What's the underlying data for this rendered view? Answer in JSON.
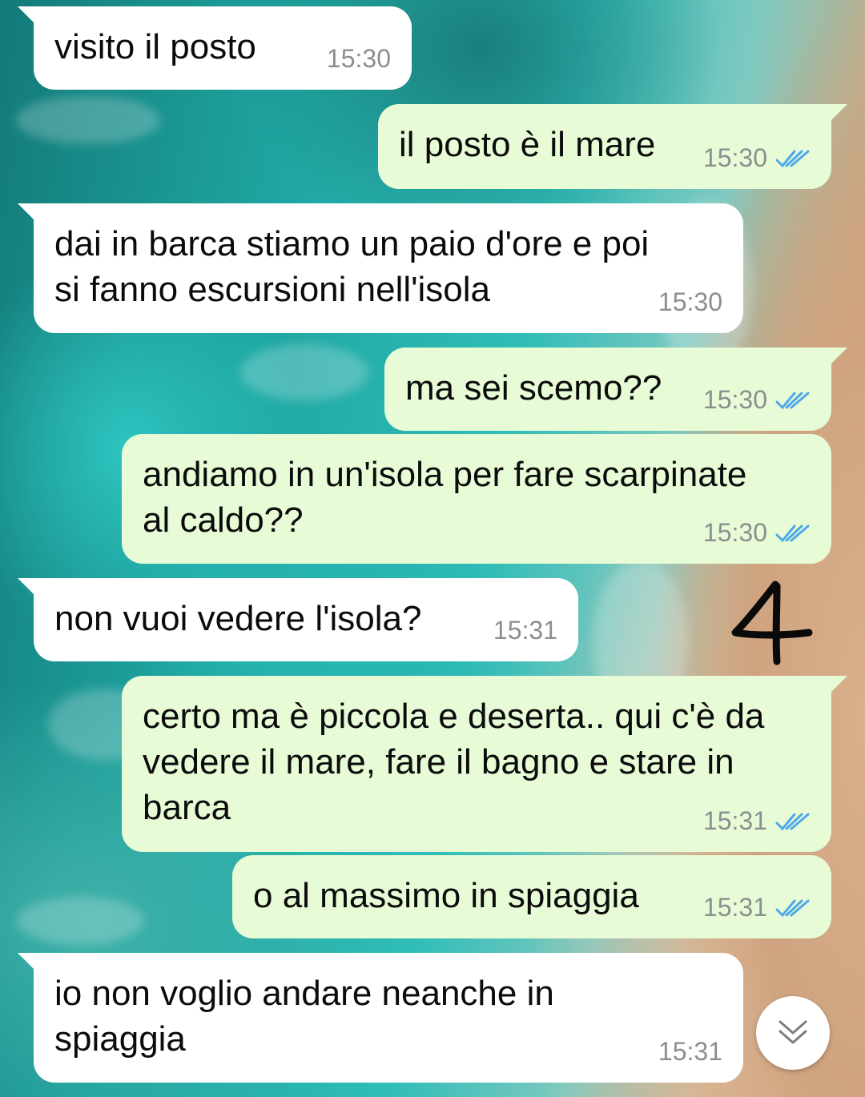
{
  "chat": {
    "messages": [
      {
        "direction": "incoming",
        "text": "visito il posto",
        "time": "15:30"
      },
      {
        "direction": "outgoing",
        "text": "il posto è il mare",
        "time": "15:30",
        "status": "read"
      },
      {
        "direction": "incoming",
        "text": "dai in barca stiamo un paio d'ore e poi\nsi fanno escursioni nell'isola",
        "time": "15:30"
      },
      {
        "direction": "outgoing",
        "text": "ma sei scemo??",
        "time": "15:30",
        "status": "read"
      },
      {
        "direction": "outgoing",
        "text": "andiamo in un'isola per fare scarpinate\nal caldo??",
        "time": "15:30",
        "status": "read"
      },
      {
        "direction": "incoming",
        "text": "non vuoi vedere l'isola?",
        "time": "15:31"
      },
      {
        "direction": "outgoing",
        "text": "certo ma è piccola e deserta.. qui c'è da\nvedere il mare, fare il bagno e stare in\nbarca",
        "time": "15:31",
        "status": "read"
      },
      {
        "direction": "outgoing",
        "text": "o al massimo in spiaggia",
        "time": "15:31",
        "status": "read"
      },
      {
        "direction": "incoming",
        "text": "io non voglio andare neanche in\nspiaggia",
        "time": "15:31"
      }
    ]
  },
  "annotation": {
    "label": "4"
  },
  "scroll_button": {
    "icon": "double-chevron-down-icon"
  },
  "colors": {
    "incoming_bubble": "#ffffff",
    "outgoing_bubble": "#e8fbd7",
    "read_ticks": "#4fa9e8",
    "timestamp": "#8a8f8d"
  }
}
